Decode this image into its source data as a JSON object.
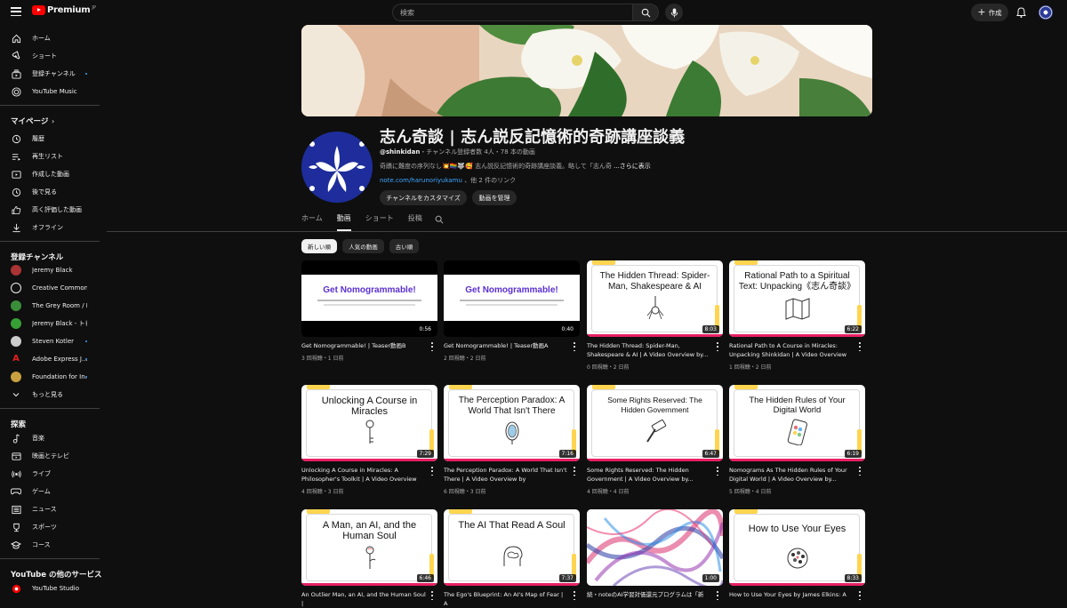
{
  "header": {
    "logo_text": "Premium",
    "logo_sup": "JP",
    "search_placeholder": "検索",
    "create_label": "作成"
  },
  "sidebar": {
    "main": [
      {
        "label": "ホーム",
        "icon": "home-icon"
      },
      {
        "label": "ショート",
        "icon": "shorts-icon"
      },
      {
        "label": "登録チャンネル",
        "icon": "subscriptions-icon"
      },
      {
        "label": "YouTube Music",
        "icon": "music-icon"
      }
    ],
    "mypage_title": "マイページ",
    "mypage": [
      {
        "label": "履歴",
        "icon": "history-icon"
      },
      {
        "label": "再生リスト",
        "icon": "playlist-icon"
      },
      {
        "label": "作成した動画",
        "icon": "your-videos-icon"
      },
      {
        "label": "後で見る",
        "icon": "watch-later-icon"
      },
      {
        "label": "高く評価した動画",
        "icon": "like-icon"
      },
      {
        "label": "オフライン",
        "icon": "download-icon"
      }
    ],
    "subs_title": "登録チャンネル",
    "subs": [
      {
        "label": "Jeremy Black",
        "color": "#a33"
      },
      {
        "label": "Creative Commons",
        "color": "#eee"
      },
      {
        "label": "The Grey Room / D...",
        "color": "#3a8e3a"
      },
      {
        "label": "Jeremy Black - トピ...",
        "color": "#37a035"
      },
      {
        "label": "Steven Kotler",
        "color": "#ccc"
      },
      {
        "label": "Adobe Express J...",
        "color": "#e02020"
      },
      {
        "label": "Foundation for In...",
        "color": "#c8a040"
      }
    ],
    "more_label": "もっと見る",
    "explore_title": "探索",
    "explore": [
      {
        "label": "音楽",
        "icon": "music-note-icon"
      },
      {
        "label": "映画とテレビ",
        "icon": "movie-icon"
      },
      {
        "label": "ライブ",
        "icon": "live-icon"
      },
      {
        "label": "ゲーム",
        "icon": "gaming-icon"
      },
      {
        "label": "ニュース",
        "icon": "news-icon"
      },
      {
        "label": "スポーツ",
        "icon": "sports-icon"
      },
      {
        "label": "コース",
        "icon": "course-icon"
      }
    ],
    "other_title": "YouTube の他のサービス",
    "other": [
      {
        "label": "YouTube Studio",
        "icon": "studio-icon"
      }
    ]
  },
  "channel": {
    "title": "志ん奇談 | 志ん説反記憶術的奇跡講座談義",
    "handle": "@shinkidan",
    "meta": "・チャンネル登録者数 4人・78 本の動画",
    "description": "奇蹟に難度の序列なし💥🏳️‍🌈🐺🥰 志ん説反記憶術的奇跡講座談義。略して「志ん奇",
    "more": "...さらに表示",
    "link_url": "note.com/harunoriyukamu",
    "link_more": "、他 2 件のリンク",
    "customize_label": "チャンネルをカスタマイズ",
    "manage_label": "動画を管理"
  },
  "tabs": [
    "ホーム",
    "動画",
    "ショート",
    "投稿"
  ],
  "chips": [
    "新しい順",
    "人気の動画",
    "古い順"
  ],
  "videos": [
    {
      "title": "Get Nomogrammable! | Teaser動画B",
      "meta": "3 回視聴・1 日前",
      "duration": "0:56",
      "thumb_type": "promo",
      "thumb_text": "Get Nomogrammable!"
    },
    {
      "title": "Get Nomogrammable! | Teaser動画A",
      "meta": "2 回視聴・2 日前",
      "duration": "0:40",
      "thumb_type": "promo",
      "thumb_text": "Get Nomogrammable!"
    },
    {
      "title": "The Hidden Thread: Spider-Man, Shakespeare & AI | A Video Overview by...",
      "meta": "0 回視聴・2 日前",
      "duration": "8:03",
      "thumb_type": "notebook",
      "thumb_text": "The Hidden Thread: Spider-Man, Shakespeare & AI"
    },
    {
      "title": "Rational Path to A Course in Miracles: Unpacking Shinkidan | A Video Overview by...",
      "meta": "1 回視聴・2 日前",
      "duration": "6:22",
      "thumb_type": "notebook",
      "thumb_text": "Rational Path to a Spiritual Text: Unpacking《志ん奇談》"
    },
    {
      "title": "Unlocking A Course in Miracles: A Philosopher's Toolkit | A Video Overview by...",
      "meta": "4 回視聴・3 日前",
      "duration": "7:29",
      "thumb_type": "notebook",
      "thumb_text": "Unlocking A Course in Miracles"
    },
    {
      "title": "The Perception Paradox: A World That Isn't There | A Video Overview by NotebookLM...",
      "meta": "6 回視聴・3 日前",
      "duration": "7:16",
      "thumb_type": "notebook",
      "thumb_text": "The Perception Paradox: A World That Isn't There"
    },
    {
      "title": "Some Rights Reserved: The Hidden Government | A Video Overview by...",
      "meta": "4 回視聴・4 日前",
      "duration": "6:47",
      "thumb_type": "notebook",
      "thumb_text": "Some Rights Reserved: The Hidden Government"
    },
    {
      "title": "Nomograms As The Hidden Rules of Your Digital World | A Video Overview by...",
      "meta": "5 回視聴・4 日前",
      "duration": "6:19",
      "thumb_type": "notebook",
      "thumb_text": "The Hidden Rules of Your Digital World"
    },
    {
      "title": "An Outlier Man, an AI, and the Human Soul |",
      "meta": "",
      "duration": "6:46",
      "thumb_type": "notebook",
      "thumb_text": "A Man, an AI, and the Human Soul"
    },
    {
      "title": "The Ego's Blueprint: An AI's Map of Fear | A",
      "meta": "",
      "duration": "7:37",
      "thumb_type": "notebook",
      "thumb_text": "The AI That Read A Soul"
    },
    {
      "title": "続・noteのAI学習対価還元プログラムは「新",
      "meta": "",
      "duration": "1:00",
      "thumb_type": "art",
      "thumb_text": ""
    },
    {
      "title": "How to Use Your Eyes by James Elkins: A",
      "meta": "",
      "duration": "8:33",
      "thumb_type": "notebook",
      "thumb_text": "How to Use Your Eyes"
    }
  ]
}
